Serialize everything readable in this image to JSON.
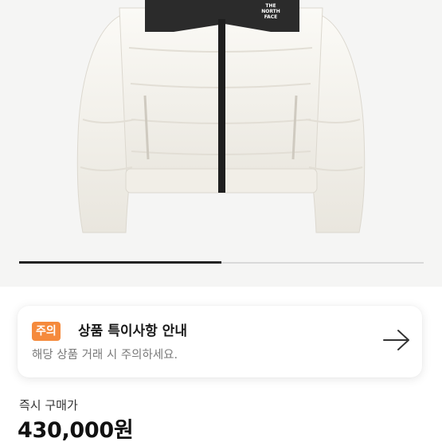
{
  "product": {
    "brand_print": [
      "THE",
      "NORTH",
      "FACE"
    ],
    "colors": {
      "jacket": "#f4f1ea",
      "yoke": "#2b2b2b",
      "zipper": "#1f1f1f"
    }
  },
  "carousel": {
    "progress": 0.5
  },
  "notice": {
    "badge": "주의",
    "title": "상품 특이사항 안내",
    "description": "해당 상품 거래 시 주의하세요.",
    "icon": "arrow-right-icon",
    "badge_color": "#f58a3c"
  },
  "price": {
    "label": "즉시 구매가",
    "value": "430,000원"
  }
}
